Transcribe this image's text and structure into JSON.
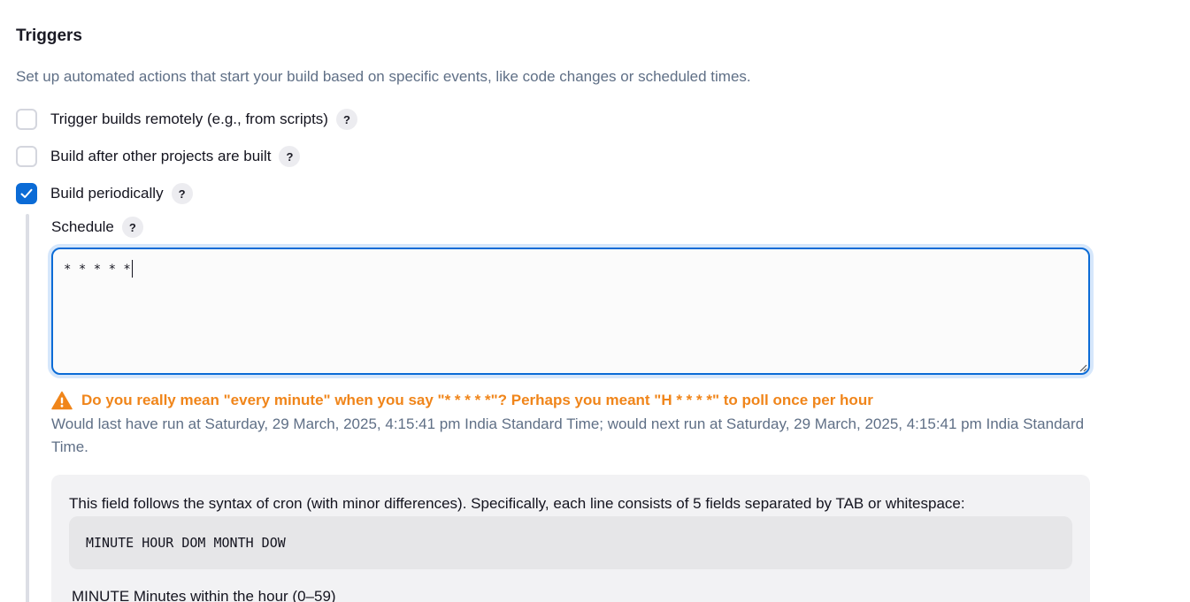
{
  "triggers": {
    "title": "Triggers",
    "description": "Set up automated actions that start your build based on specific events, like code changes or scheduled times.",
    "options": [
      {
        "label": "Trigger builds remotely (e.g., from scripts)",
        "checked": false
      },
      {
        "label": "Build after other projects are built",
        "checked": false
      },
      {
        "label": "Build periodically",
        "checked": true
      }
    ],
    "help_label": "?"
  },
  "schedule": {
    "label": "Schedule",
    "value": "* * * * *",
    "warning": "Do you really mean \"every minute\" when you say \"* * * * *\"? Perhaps you meant \"H * * * *\" to poll once per hour",
    "next_run": "Would last have run at Saturday, 29 March, 2025, 4:15:41 pm India Standard Time; would next run at Saturday, 29 March, 2025, 4:15:41 pm India Standard Time."
  },
  "help_panel": {
    "intro": "This field follows the syntax of cron (with minor differences). Specifically, each line consists of 5 fields separated by TAB or whitespace:",
    "code": "MINUTE HOUR DOM MONTH DOW",
    "minute_line": "MINUTE Minutes within the hour (0–59)"
  },
  "colors": {
    "accent": "#0b6bd6",
    "warning": "#f0851a",
    "muted_text": "#5f6f86"
  },
  "icons": {
    "warning": "warning-triangle-icon",
    "check": "checkmark-icon",
    "help": "question-mark-icon"
  }
}
